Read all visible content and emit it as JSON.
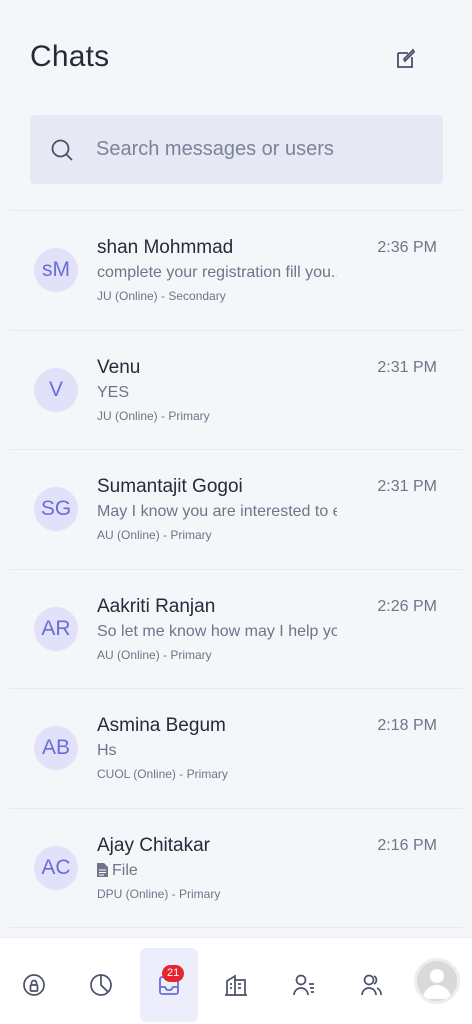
{
  "header": {
    "title": "Chats",
    "compose_icon": "compose-icon"
  },
  "search": {
    "placeholder": "Search messages or users"
  },
  "chats": [
    {
      "initials": "sM",
      "name": "shan Mohmmad",
      "message": "complete your registration fill you...",
      "meta": "JU (Online) - Secondary",
      "time": "2:36 PM"
    },
    {
      "initials": "V",
      "name": "Venu",
      "message": "YES",
      "meta": "JU (Online) - Primary",
      "time": "2:31 PM"
    },
    {
      "initials": "SG",
      "name": "Sumantajit Gogoi",
      "message": "May I know you are interested to en...",
      "meta": "AU (Online) - Primary",
      "time": "2:31 PM"
    },
    {
      "initials": "AR",
      "name": "Aakriti Ranjan",
      "message": "So let me know how may I help you ...",
      "meta": "AU (Online) - Primary",
      "time": "2:26 PM"
    },
    {
      "initials": "AB",
      "name": "Asmina Begum",
      "message": "Hs",
      "meta": "CUOL (Online) - Primary",
      "time": "2:18 PM"
    },
    {
      "initials": "AC",
      "name": "Ajay Chitakar",
      "message": "File",
      "meta": "DPU (Online) - Primary",
      "time": "2:16 PM"
    }
  ],
  "tabbar": {
    "badge": "21",
    "icons": [
      "at-lock-icon",
      "pie-chart-icon",
      "inbox-icon",
      "building-icon",
      "user-list-icon",
      "users-icon",
      "profile-avatar-icon"
    ]
  },
  "colors": {
    "accent": "#6b6dd6",
    "avatar_bg": "#e1e1fa",
    "badge": "#e5252f",
    "background": "#f5f6fa"
  }
}
